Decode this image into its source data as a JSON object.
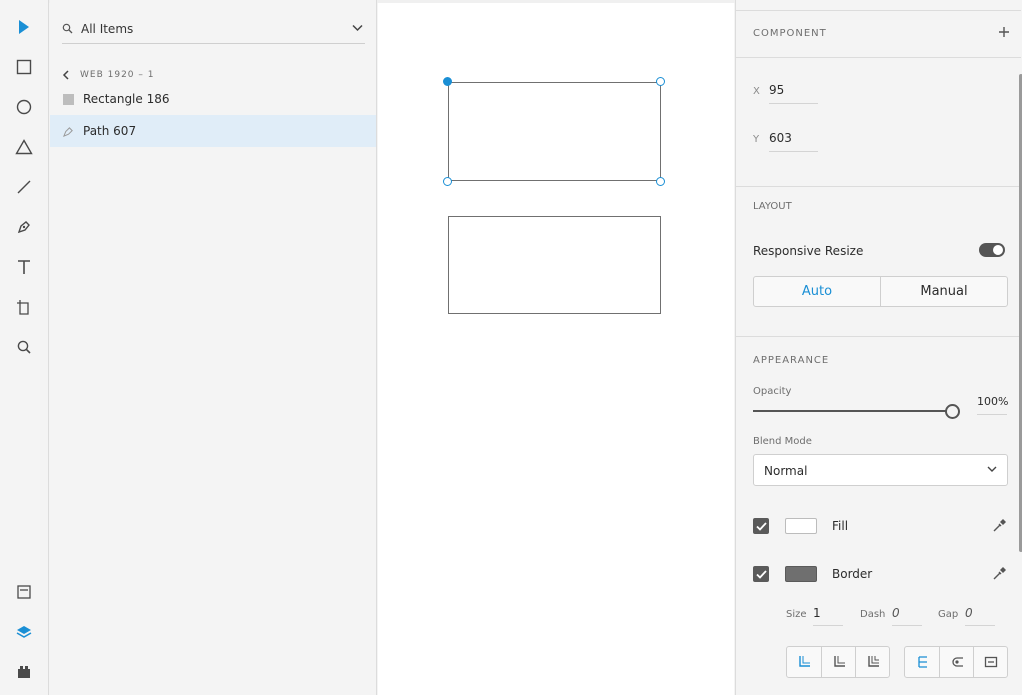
{
  "colors": {
    "accent": "#1a8fd5",
    "stroke": "#707070",
    "panel_bg": "#f4f4f4",
    "selected_row_bg": "#e0edf8",
    "border_swatch": "#6f6f6f",
    "fill_swatch": "#ffffff"
  },
  "toolbar": {
    "tools": [
      {
        "name": "select-tool",
        "icon": "arrow-icon",
        "active": true
      },
      {
        "name": "rectangle-tool",
        "icon": "rectangle-icon"
      },
      {
        "name": "ellipse-tool",
        "icon": "ellipse-icon"
      },
      {
        "name": "polygon-tool",
        "icon": "triangle-icon"
      },
      {
        "name": "line-tool",
        "icon": "line-icon"
      },
      {
        "name": "pen-tool",
        "icon": "pen-icon"
      },
      {
        "name": "text-tool",
        "icon": "text-icon"
      },
      {
        "name": "artboard-tool",
        "icon": "artboard-icon"
      },
      {
        "name": "zoom-tool",
        "icon": "search-icon"
      }
    ],
    "bottom": [
      {
        "name": "assets-button",
        "icon": "assets-icon"
      },
      {
        "name": "layers-button",
        "icon": "layers-icon",
        "active": true
      },
      {
        "name": "plugins-button",
        "icon": "plugins-icon"
      }
    ]
  },
  "layers": {
    "filter_label": "All Items",
    "breadcrumb": "WEB 1920 – 1",
    "items": [
      {
        "label": "Rectangle 186",
        "type": "rectangle"
      },
      {
        "label": "Path 607",
        "type": "path",
        "selected": true
      }
    ]
  },
  "inspector": {
    "component_title": "COMPONENT",
    "x_label": "X",
    "x_value": "95",
    "y_label": "Y",
    "y_value": "603",
    "layout_title": "LAYOUT",
    "responsive_label": "Responsive Resize",
    "responsive_on": true,
    "resize_modes": [
      "Auto",
      "Manual"
    ],
    "resize_active": "Auto",
    "appearance_title": "APPEARANCE",
    "opacity_label": "Opacity",
    "opacity_value": "100%",
    "opacity_fraction": 1.0,
    "blend_label": "Blend Mode",
    "blend_value": "Normal",
    "fill_label": "Fill",
    "fill_checked": true,
    "border_label": "Border",
    "border_checked": true,
    "size_label": "Size",
    "size_value": "1",
    "dash_label": "Dash",
    "dash_value": "0",
    "gap_label": "Gap",
    "gap_value": "0"
  }
}
